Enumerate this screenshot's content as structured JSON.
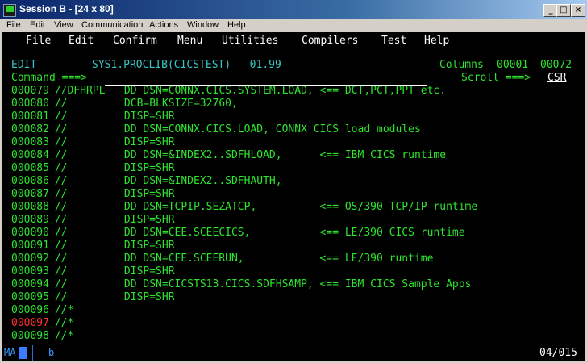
{
  "window": {
    "title": "Session B - [24 x 80]",
    "buttons": {
      "minimize": "_",
      "maximize": "□",
      "close": "×"
    }
  },
  "menubar": [
    "File",
    "Edit",
    "View",
    "Communication",
    "Actions",
    "Window",
    "Help"
  ],
  "actionbar": [
    "File",
    "Edit",
    "Confirm",
    "Menu",
    "Utilities",
    "Compilers",
    "Test",
    "Help"
  ],
  "editor": {
    "mode": "EDIT",
    "dataset": "SYS1.PROCLIB(CICSTEST) - 01.99",
    "columns_label": "Columns",
    "col_from": "00001",
    "col_to": "00072",
    "command_prompt": "Command ===>",
    "command_value": "",
    "scroll_prompt": "Scroll ===>",
    "scroll_value": "CSR"
  },
  "lines": [
    {
      "num": "000079",
      "text": " //DFHRPL   DD DSN=CONNX.CICS.SYSTEM.LOAD, <== DCT,PCT,PPT etc."
    },
    {
      "num": "000080",
      "text": " //         DCB=BLKSIZE=32760,"
    },
    {
      "num": "000081",
      "text": " //         DISP=SHR"
    },
    {
      "num": "000082",
      "text": " //         DD DSN=CONNX.CICS.LOAD, CONNX CICS load modules"
    },
    {
      "num": "000083",
      "text": " //         DISP=SHR"
    },
    {
      "num": "000084",
      "text": " //         DD DSN=&INDEX2..SDFHLOAD,      <== IBM CICS runtime"
    },
    {
      "num": "000085",
      "text": " //         DISP=SHR"
    },
    {
      "num": "000086",
      "text": " //         DD DSN=&INDEX2..SDFHAUTH,"
    },
    {
      "num": "000087",
      "text": " //         DISP=SHR"
    },
    {
      "num": "000088",
      "text": " //         DD DSN=TCPIP.SEZATCP,          <== OS/390 TCP/IP runtime"
    },
    {
      "num": "000089",
      "text": " //         DISP=SHR"
    },
    {
      "num": "000090",
      "text": " //         DD DSN=CEE.SCEECICS,           <== LE/390 CICS runtime"
    },
    {
      "num": "000091",
      "text": " //         DISP=SHR"
    },
    {
      "num": "000092",
      "text": " //         DD DSN=CEE.SCEERUN,            <== LE/390 runtime"
    },
    {
      "num": "000093",
      "text": " //         DISP=SHR"
    },
    {
      "num": "000094",
      "text": " //         DD DSN=CICSTS13.CICS.SDFHSAMP, <== IBM CICS Sample Apps"
    },
    {
      "num": "000095",
      "text": " //         DISP=SHR"
    },
    {
      "num": "000096",
      "text": " //*"
    },
    {
      "num": "000097",
      "text": " //*",
      "highlight": "#ff3030"
    },
    {
      "num": "000098",
      "text": " //*"
    }
  ],
  "status": {
    "left": "MA",
    "mode": "b",
    "position": "04/015"
  },
  "colors": {
    "green": "#2ee32e",
    "cyan": "#38c5c5",
    "red": "#ff3030",
    "oia_blue": "#3a7bff"
  }
}
